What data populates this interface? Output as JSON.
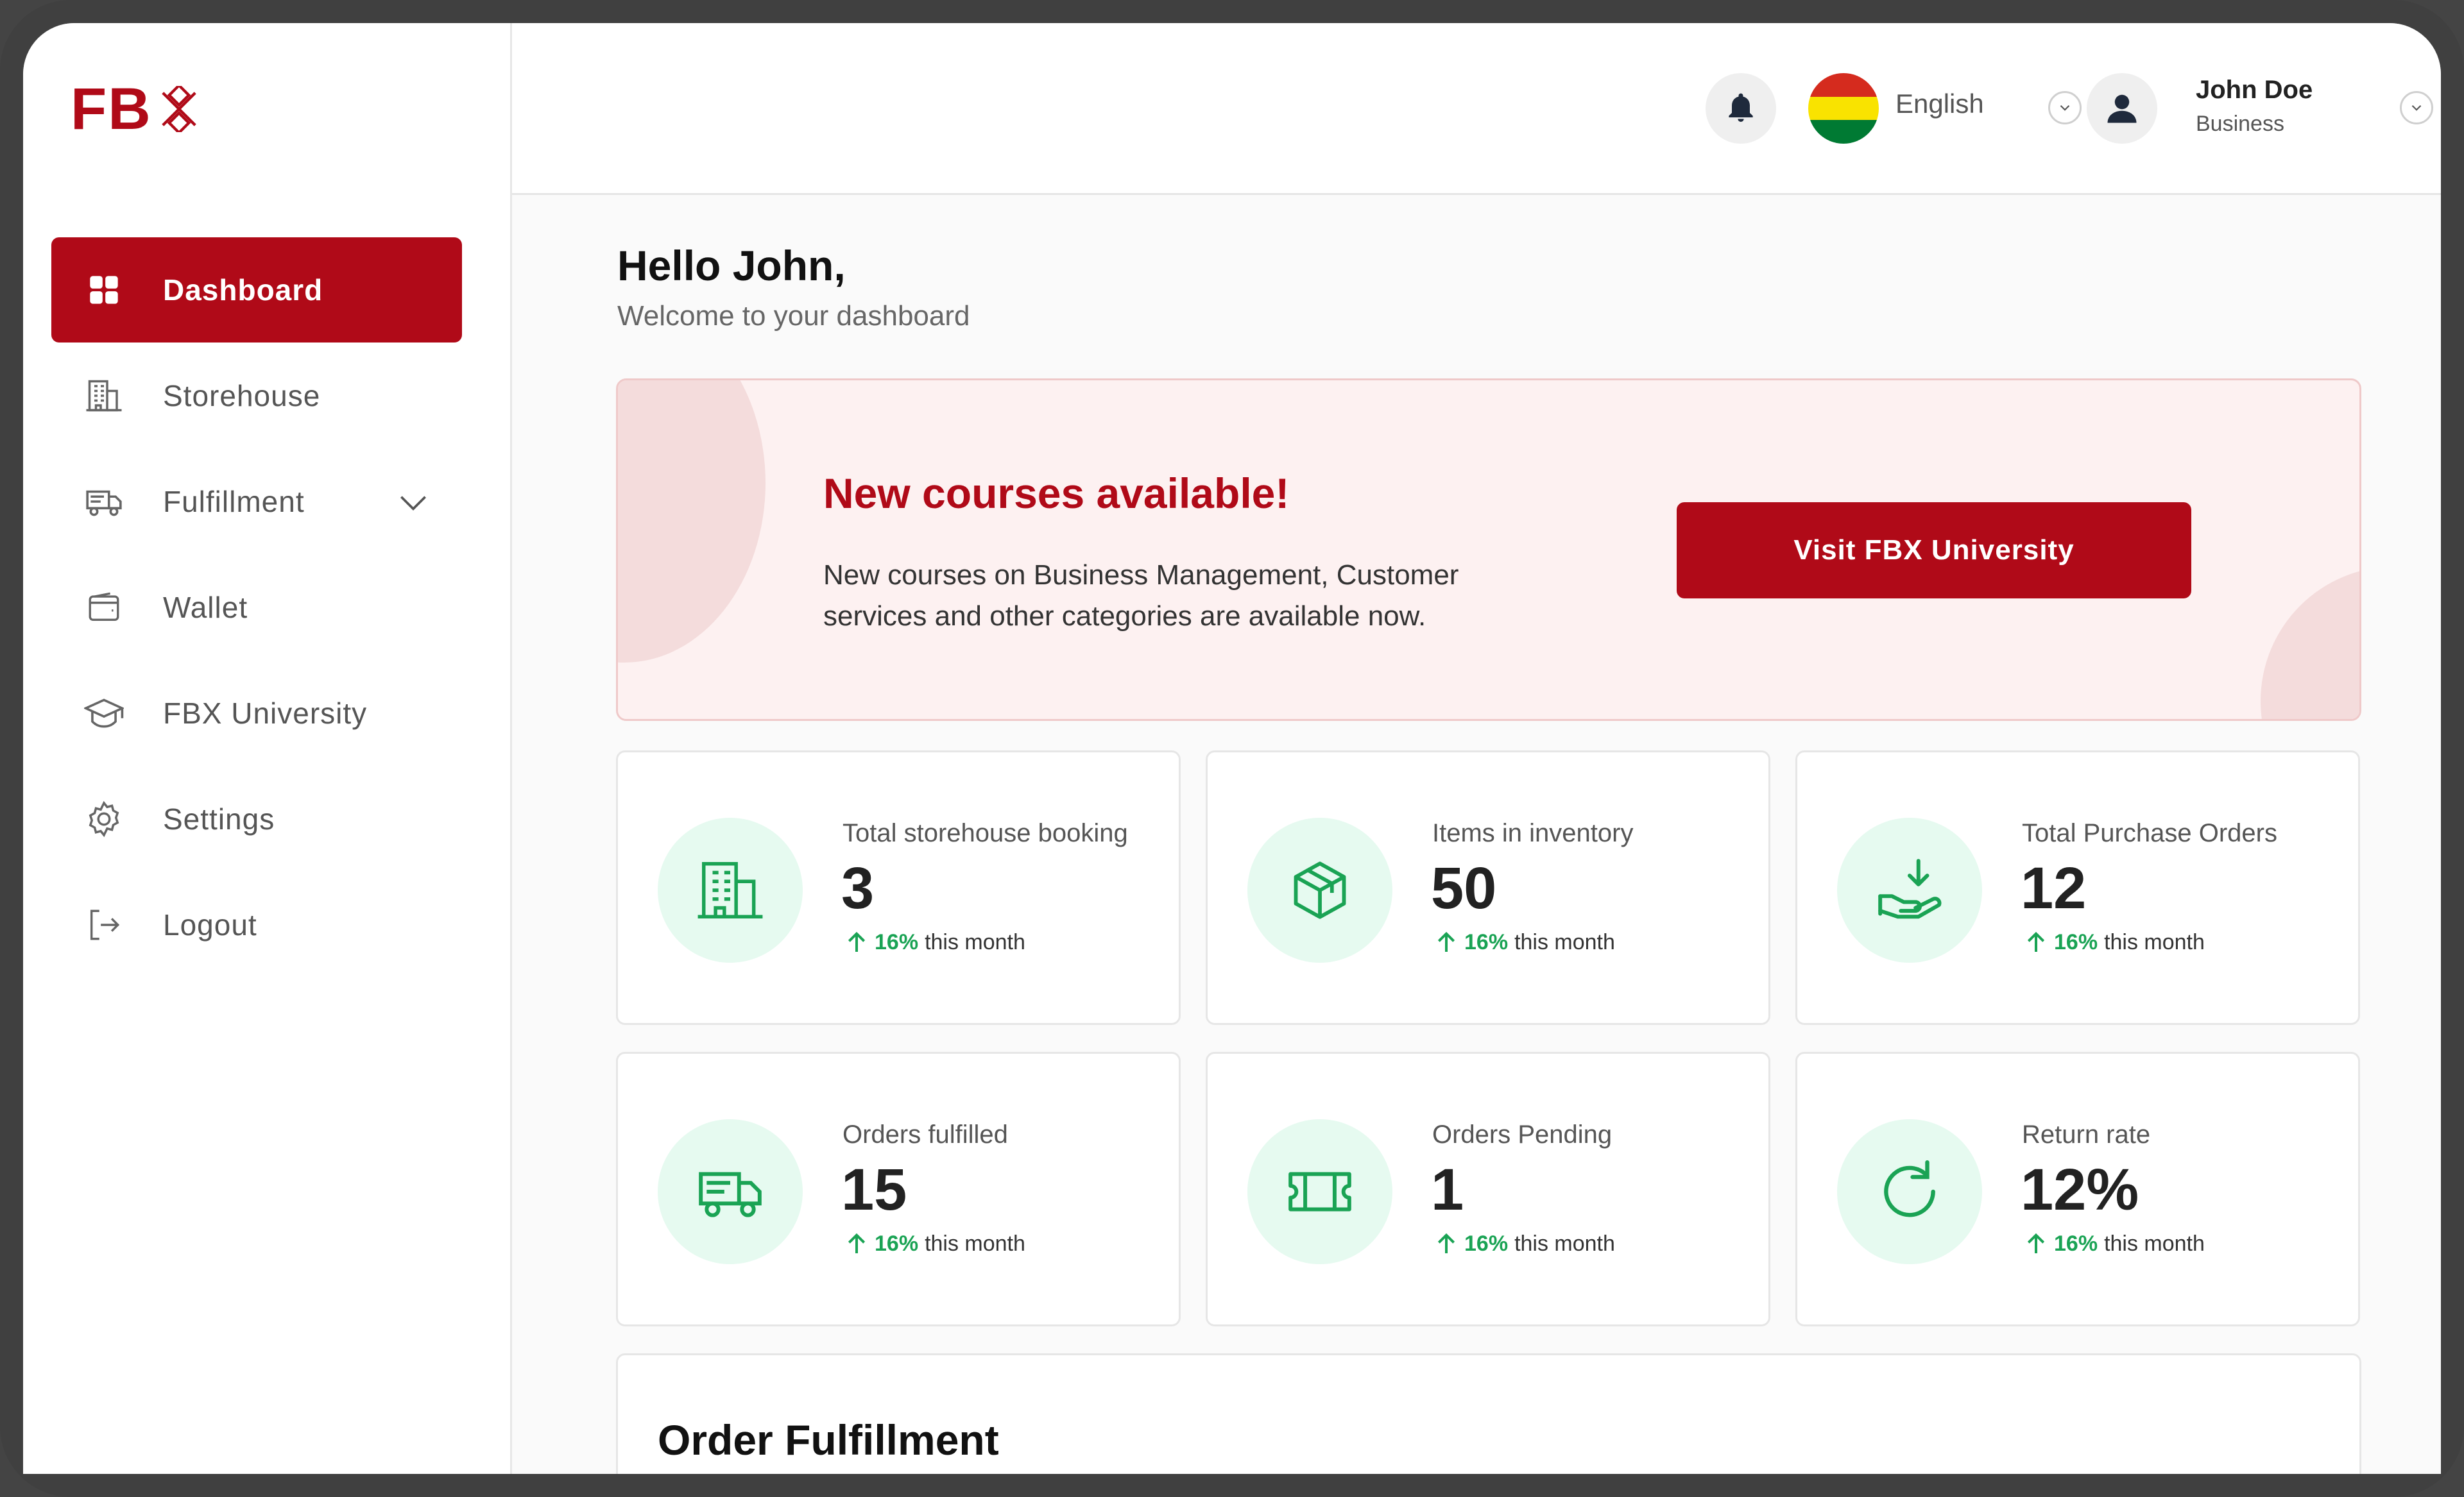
{
  "brand": {
    "logo_text": "FB"
  },
  "sidebar": {
    "items": [
      {
        "label": "Dashboard",
        "icon": "dashboard-grid-icon",
        "active": true
      },
      {
        "label": "Storehouse",
        "icon": "building-icon"
      },
      {
        "label": "Fulfillment",
        "icon": "truck-icon",
        "expandable": true
      },
      {
        "label": "Wallet",
        "icon": "wallet-icon"
      },
      {
        "label": "FBX University",
        "icon": "graduation-cap-icon"
      },
      {
        "label": "Settings",
        "icon": "gear-icon"
      },
      {
        "label": "Logout",
        "icon": "logout-icon"
      }
    ]
  },
  "header": {
    "language": "English",
    "user": {
      "name": "John Doe",
      "role": "Business"
    }
  },
  "main": {
    "greeting": "Hello John,",
    "subtitle": "Welcome to your dashboard",
    "banner": {
      "title": "New courses available!",
      "text": "New courses on Business Management, Customer services and other categories are available now.",
      "button": "Visit FBX University"
    },
    "stats": [
      {
        "label": "Total storehouse booking",
        "value": "3",
        "trend_pct": "16%",
        "trend_text": "this month",
        "icon": "building-icon"
      },
      {
        "label": "Items in inventory",
        "value": "50",
        "trend_pct": "16%",
        "trend_text": "this month",
        "icon": "box-icon"
      },
      {
        "label": "Total Purchase Orders",
        "value": "12",
        "trend_pct": "16%",
        "trend_text": "this month",
        "icon": "hand-receive-icon"
      },
      {
        "label": "Orders fulfilled",
        "value": "15",
        "trend_pct": "16%",
        "trend_text": "this month",
        "icon": "truck-icon"
      },
      {
        "label": "Orders Pending",
        "value": "1",
        "trend_pct": "16%",
        "trend_text": "this month",
        "icon": "ticket-icon"
      },
      {
        "label": "Return rate",
        "value": "12%",
        "trend_pct": "16%",
        "trend_text": "this month",
        "icon": "refresh-icon"
      }
    ],
    "order_section_title": "Order Fulfillment"
  },
  "colors": {
    "brand": "#b00a18",
    "accent_green": "#1aa354",
    "icon_bg": "#e6faf0",
    "banner_bg": "#fdf1f1"
  }
}
